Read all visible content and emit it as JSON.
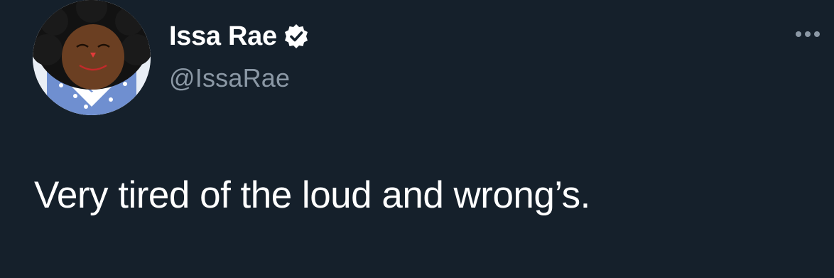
{
  "author": {
    "display_name": "Issa Rae",
    "handle": "@IssaRae",
    "verified": true,
    "avatar_icon": "ragdoll-avatar"
  },
  "tweet": {
    "text": "Very tired of the loud and wrong’s."
  },
  "actions": {
    "more_icon": "more-horizontal-icon"
  },
  "colors": {
    "background": "#15202b",
    "primary_text": "#ffffff",
    "secondary_text": "#8b98a5"
  }
}
